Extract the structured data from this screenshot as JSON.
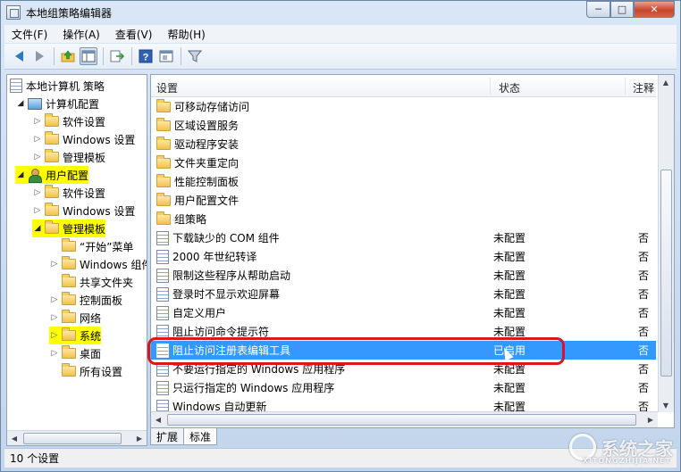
{
  "window": {
    "title": "本地组策略编辑器",
    "buttons": {
      "minimize": "─",
      "maximize": "□",
      "close": "✕"
    }
  },
  "menu": [
    "文件(F)",
    "操作(A)",
    "查看(V)",
    "帮助(H)"
  ],
  "toolbar_icons": [
    "back-icon",
    "forward-icon",
    "up-folder-icon",
    "show-hide-tree-icon",
    "export-list-icon",
    "help-icon",
    "properties-icon",
    "filter-icon"
  ],
  "tree": {
    "root": "本地计算机 策略",
    "computer_config": "计算机配置",
    "computer_children": [
      "软件设置",
      "Windows 设置",
      "管理模板"
    ],
    "user_config": "用户配置",
    "user_children": [
      "软件设置",
      "Windows 设置"
    ],
    "admin_templates": "管理模板",
    "admin_children": [
      "“开始”菜单",
      "Windows 组件",
      "共享文件夹",
      "控制面板",
      "网络",
      "系统",
      "桌面",
      "所有设置"
    ]
  },
  "list": {
    "headers": {
      "setting": "设置",
      "state": "状态",
      "note": "注释"
    },
    "folders": [
      "可移动存储访问",
      "区域设置服务",
      "驱动程序安装",
      "文件夹重定向",
      "性能控制面板",
      "用户配置文件",
      "组策略"
    ],
    "policies": [
      {
        "name": "下载缺少的 COM 组件",
        "state": "未配置",
        "note": "否"
      },
      {
        "name": "2000 年世纪转译",
        "state": "未配置",
        "note": "否"
      },
      {
        "name": "限制这些程序从帮助启动",
        "state": "未配置",
        "note": "否"
      },
      {
        "name": "登录时不显示欢迎屏幕",
        "state": "未配置",
        "note": "否"
      },
      {
        "name": "自定义用户",
        "state": "未配置",
        "note": "否"
      },
      {
        "name": "阻止访问命令提示符",
        "state": "未配置",
        "note": "否"
      },
      {
        "name": "阻止访问注册表编辑工具",
        "state": "已启用",
        "note": "否"
      },
      {
        "name": "不要运行指定的 Windows 应用程序",
        "state": "未配置",
        "note": "否"
      },
      {
        "name": "只运行指定的 Windows 应用程序",
        "state": "未配置",
        "note": "否"
      },
      {
        "name": "Windows 自动更新",
        "state": "未配置",
        "note": "否"
      }
    ]
  },
  "tabs": [
    "扩展",
    "标准"
  ],
  "status": "10 个设置",
  "watermark": {
    "text": "系统之家",
    "sub": "XITONGZHIJIA.NET"
  },
  "colors": {
    "selection": "#3399ff",
    "highlight": "#ffff00",
    "annotation_ring": "#e0141a"
  }
}
